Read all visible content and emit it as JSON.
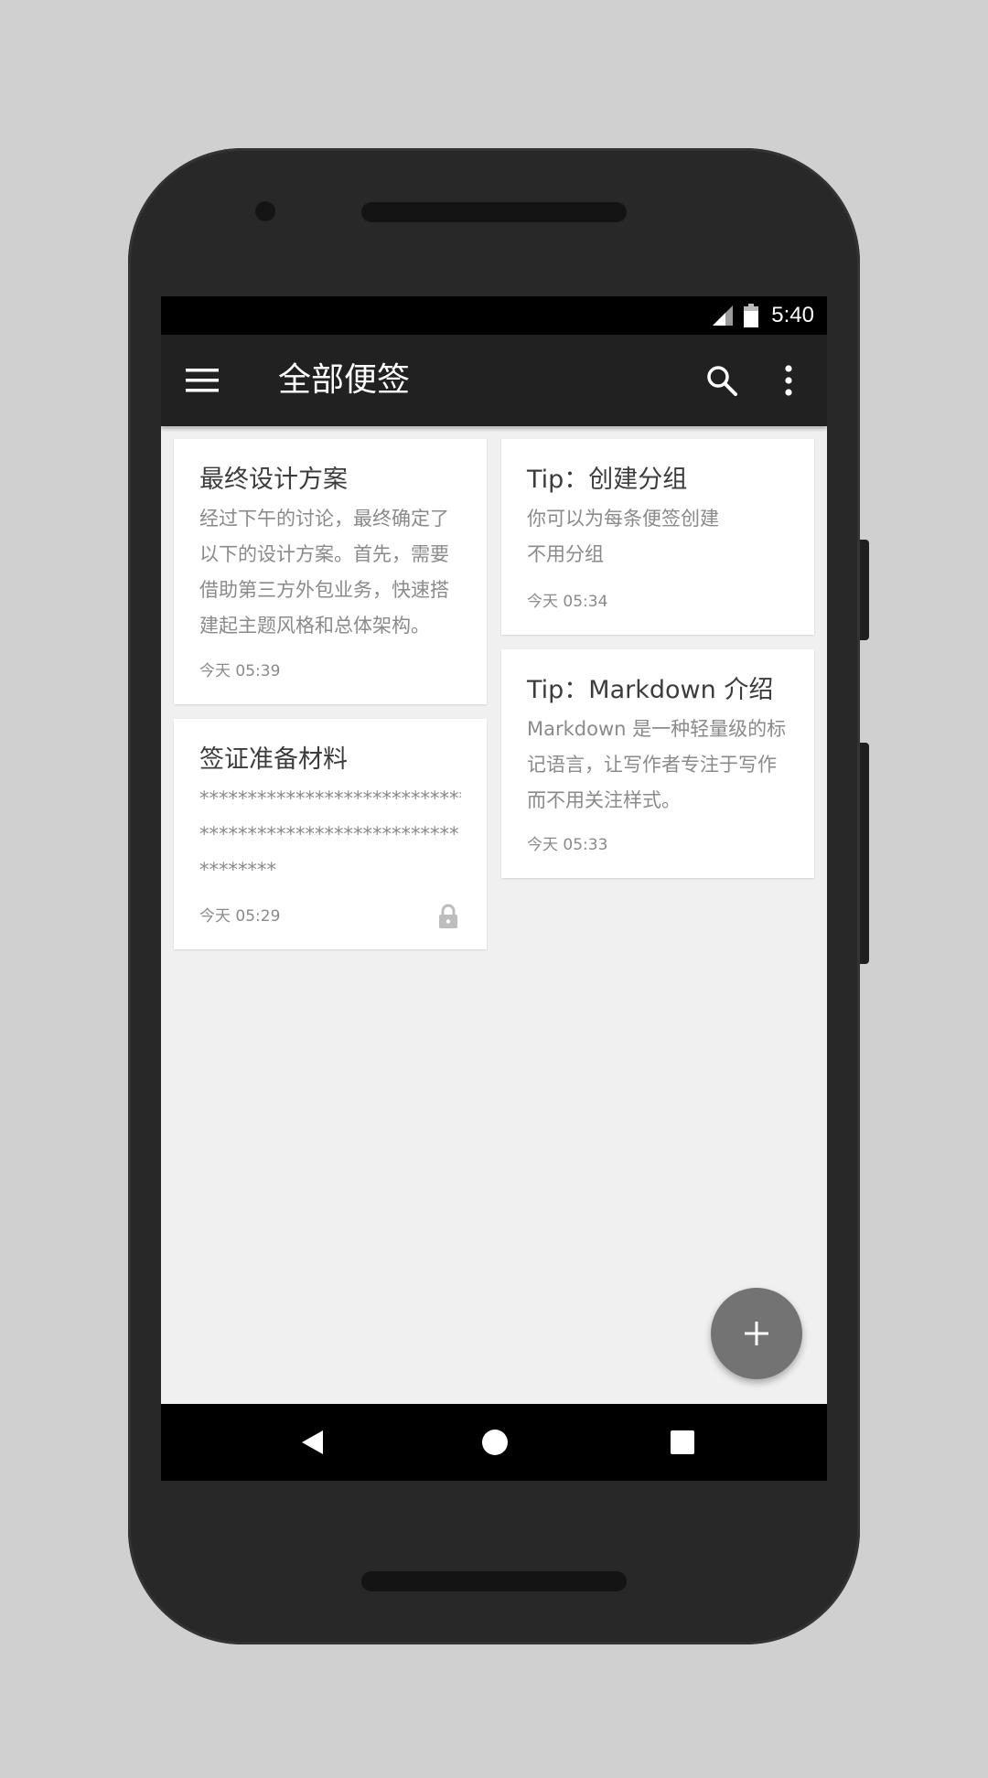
{
  "status_bar": {
    "time": "5:40",
    "icons": [
      "signal-icon",
      "battery-icon"
    ]
  },
  "app_bar": {
    "title": "全部便签",
    "icons": [
      "menu-icon",
      "search-icon",
      "more-vert-icon"
    ]
  },
  "notes": [
    {
      "title": "最终设计方案",
      "body_lines": [
        "经过下午的讨论，最终确定了",
        "以下的设计方案。首先，需要",
        "借助第三方外包业务，快速搭",
        "建起主题风格和总体架构。"
      ],
      "time": "今天 05:39",
      "locked": false
    },
    {
      "title": "Tip：创建分组",
      "body_lines": [
        "你可以为每条便签创建",
        "不用分组"
      ],
      "time": "今天 05:34",
      "locked": false
    },
    {
      "title": "签证准备材料",
      "body_lines": [
        "****************************",
        "***************************",
        "********"
      ],
      "time": "今天 05:29",
      "locked": true
    },
    {
      "title": "Tip：Markdown 介绍",
      "body_lines": [
        "Markdown 是一种轻量级的标",
        "记语言，让写作者专注于写作",
        "而不用关注样式。"
      ],
      "time": "今天 05:33",
      "locked": false
    }
  ],
  "fab": {
    "icon": "add-icon"
  },
  "nav_bar": {
    "icons": [
      "back-icon",
      "home-icon",
      "recents-icon"
    ]
  },
  "colors": {
    "background": "#d0d0d0",
    "phone": "#282828",
    "app_bar": "#212121",
    "screen": "#f0f0f0",
    "card": "#ffffff",
    "fab": "#737373"
  }
}
